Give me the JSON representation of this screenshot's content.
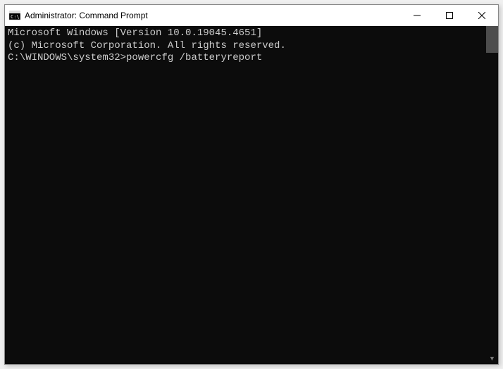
{
  "titlebar": {
    "title": "Administrator: Command Prompt"
  },
  "terminal": {
    "line1": "Microsoft Windows [Version 10.0.19045.4651]",
    "line2": "(c) Microsoft Corporation. All rights reserved.",
    "blank": "",
    "prompt_path": "C:\\WINDOWS\\system32>",
    "command": "powercfg /batteryreport"
  }
}
